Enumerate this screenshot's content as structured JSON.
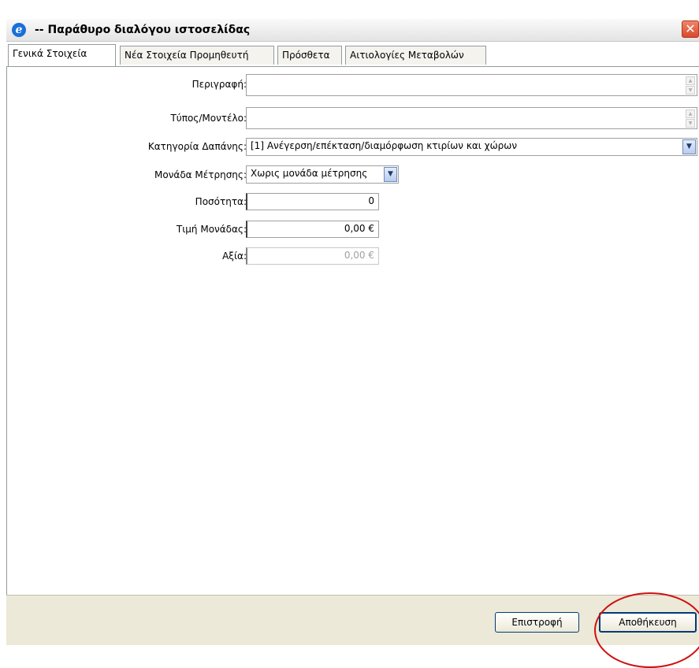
{
  "window": {
    "title": "-- Παράθυρο διαλόγου ιστοσελίδας",
    "app_icon": "ie-icon",
    "close_glyph": "✕"
  },
  "tabs": [
    {
      "label": "Γενικά Στοιχεία",
      "active": true
    },
    {
      "label": "Νέα Στοιχεία Προμηθευτή",
      "active": false
    },
    {
      "label": "Πρόσθετα",
      "active": false
    },
    {
      "label": "Αιτιολογίες Μεταβολών",
      "active": false
    }
  ],
  "form": {
    "description": {
      "label": "Περιγραφή:",
      "value": ""
    },
    "type_model": {
      "label": "Τύπος/Μοντέλο:",
      "value": ""
    },
    "expense_category": {
      "label": "Κατηγορία Δαπάνης:",
      "value": "[1] Ανέγερση/επέκταση/διαμόρφωση κτιρίων και χώρων"
    },
    "unit_of_measure": {
      "label": "Μονάδα Μέτρησης:",
      "value": "Χωρις μονάδα μέτρησης"
    },
    "quantity": {
      "label": "Ποσότητα:",
      "value": "0"
    },
    "unit_price": {
      "label": "Τιμή Μονάδας:",
      "value": "0,00 €"
    },
    "value": {
      "label": "Αξία:",
      "value": "0,00 €"
    }
  },
  "footer": {
    "back_label": "Επιστροφή",
    "save_label": "Αποθήκευση"
  },
  "colors": {
    "annotation_circle": "#d01010",
    "close_button": "#d84a2a"
  }
}
